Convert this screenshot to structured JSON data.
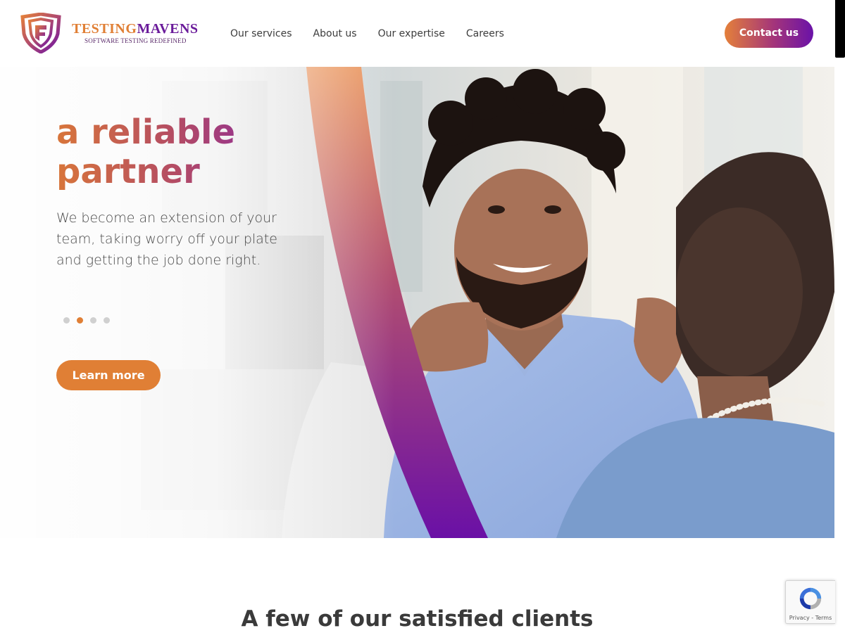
{
  "brand": {
    "word1": "TESTING",
    "word2": "MAVENS",
    "tagline": "SOFTWARE TESTING REDEFINED",
    "colors": {
      "orange": "#e07f35",
      "purple": "#6a1b9a"
    }
  },
  "nav": {
    "items": [
      {
        "label": "Our services"
      },
      {
        "label": "About us"
      },
      {
        "label": "Our expertise"
      },
      {
        "label": "Careers"
      }
    ],
    "contact_label": "Contact us"
  },
  "hero": {
    "title": "a reliable partner",
    "description": "We become an extension of your team, taking worry off your plate and getting the job done right.",
    "slides": {
      "count": 4,
      "active": 2
    },
    "cta_label": "Learn more"
  },
  "clients": {
    "title": "A few of our satisfied clients"
  },
  "recaptcha": {
    "text": "Privacy - Terms"
  },
  "icons": {
    "logo": "shield-logo-icon",
    "recaptcha": "recaptcha-icon"
  }
}
